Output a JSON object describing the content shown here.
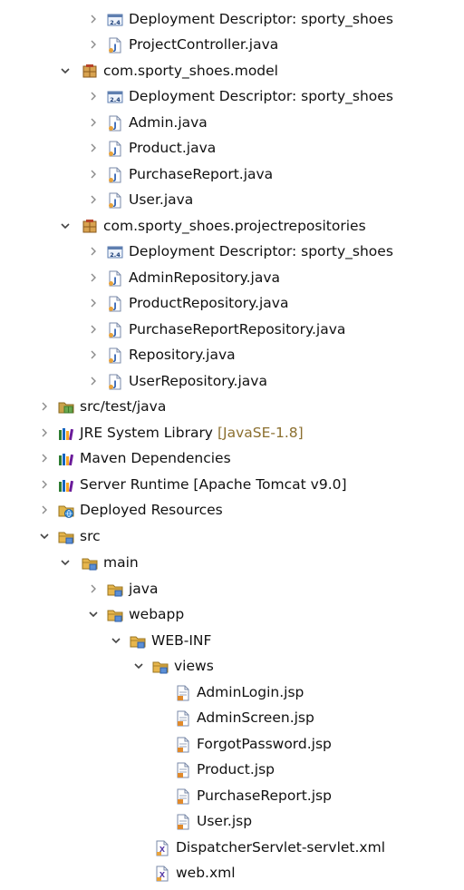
{
  "tree": [
    {
      "label": "Deployment Descriptor: sporty_shoes",
      "icon": "deployment-descriptor-icon",
      "arrow": "collapsed"
    },
    {
      "label": "ProjectController.java",
      "icon": "java-file-icon",
      "arrow": "collapsed"
    },
    {
      "label": "com.sporty_shoes.model",
      "icon": "package-icon",
      "arrow": "expanded"
    },
    {
      "label": "Deployment Descriptor: sporty_shoes",
      "icon": "deployment-descriptor-icon",
      "arrow": "collapsed"
    },
    {
      "label": "Admin.java",
      "icon": "java-file-icon",
      "arrow": "collapsed"
    },
    {
      "label": "Product.java",
      "icon": "java-file-icon",
      "arrow": "collapsed"
    },
    {
      "label": "PurchaseReport.java",
      "icon": "java-file-icon",
      "arrow": "collapsed"
    },
    {
      "label": "User.java",
      "icon": "java-file-icon",
      "arrow": "collapsed"
    },
    {
      "label": "com.sporty_shoes.projectrepositories",
      "icon": "package-icon",
      "arrow": "expanded"
    },
    {
      "label": "Deployment Descriptor: sporty_shoes",
      "icon": "deployment-descriptor-icon",
      "arrow": "collapsed"
    },
    {
      "label": "AdminRepository.java",
      "icon": "java-file-icon",
      "arrow": "collapsed"
    },
    {
      "label": "ProductRepository.java",
      "icon": "java-file-icon",
      "arrow": "collapsed"
    },
    {
      "label": "PurchaseReportRepository.java",
      "icon": "java-file-icon",
      "arrow": "collapsed"
    },
    {
      "label": "Repository.java",
      "icon": "java-file-icon",
      "arrow": "collapsed"
    },
    {
      "label": "UserRepository.java",
      "icon": "java-file-icon",
      "arrow": "collapsed"
    },
    {
      "label": "src/test/java",
      "icon": "source-folder-icon",
      "arrow": "collapsed"
    },
    {
      "label": "JRE System Library",
      "decoration": "[JavaSE-1.8]",
      "icon": "library-icon",
      "arrow": "collapsed"
    },
    {
      "label": "Maven Dependencies",
      "icon": "library-icon",
      "arrow": "collapsed"
    },
    {
      "label": "Server Runtime [Apache Tomcat v9.0]",
      "icon": "library-icon",
      "arrow": "collapsed"
    },
    {
      "label": "Deployed Resources",
      "icon": "deployed-resources-icon",
      "arrow": "collapsed"
    },
    {
      "label": "src",
      "icon": "folder-icon",
      "arrow": "expanded"
    },
    {
      "label": "main",
      "icon": "folder-icon",
      "arrow": "expanded"
    },
    {
      "label": "java",
      "icon": "folder-icon",
      "arrow": "collapsed"
    },
    {
      "label": "webapp",
      "icon": "folder-icon",
      "arrow": "expanded"
    },
    {
      "label": "WEB-INF",
      "icon": "folder-icon",
      "arrow": "expanded"
    },
    {
      "label": "views",
      "icon": "folder-icon",
      "arrow": "expanded"
    },
    {
      "label": "AdminLogin.jsp",
      "icon": "jsp-file-icon",
      "arrow": "none"
    },
    {
      "label": "AdminScreen.jsp",
      "icon": "jsp-file-icon",
      "arrow": "none"
    },
    {
      "label": "ForgotPassword.jsp",
      "icon": "jsp-file-icon",
      "arrow": "none"
    },
    {
      "label": "Product.jsp",
      "icon": "jsp-file-icon",
      "arrow": "none"
    },
    {
      "label": "PurchaseReport.jsp",
      "icon": "jsp-file-icon",
      "arrow": "none"
    },
    {
      "label": "User.jsp",
      "icon": "jsp-file-icon",
      "arrow": "none"
    },
    {
      "label": "DispatcherServlet-servlet.xml",
      "icon": "xml-file-icon",
      "arrow": "none"
    },
    {
      "label": "web.xml",
      "icon": "xml-file-icon",
      "arrow": "none"
    }
  ]
}
